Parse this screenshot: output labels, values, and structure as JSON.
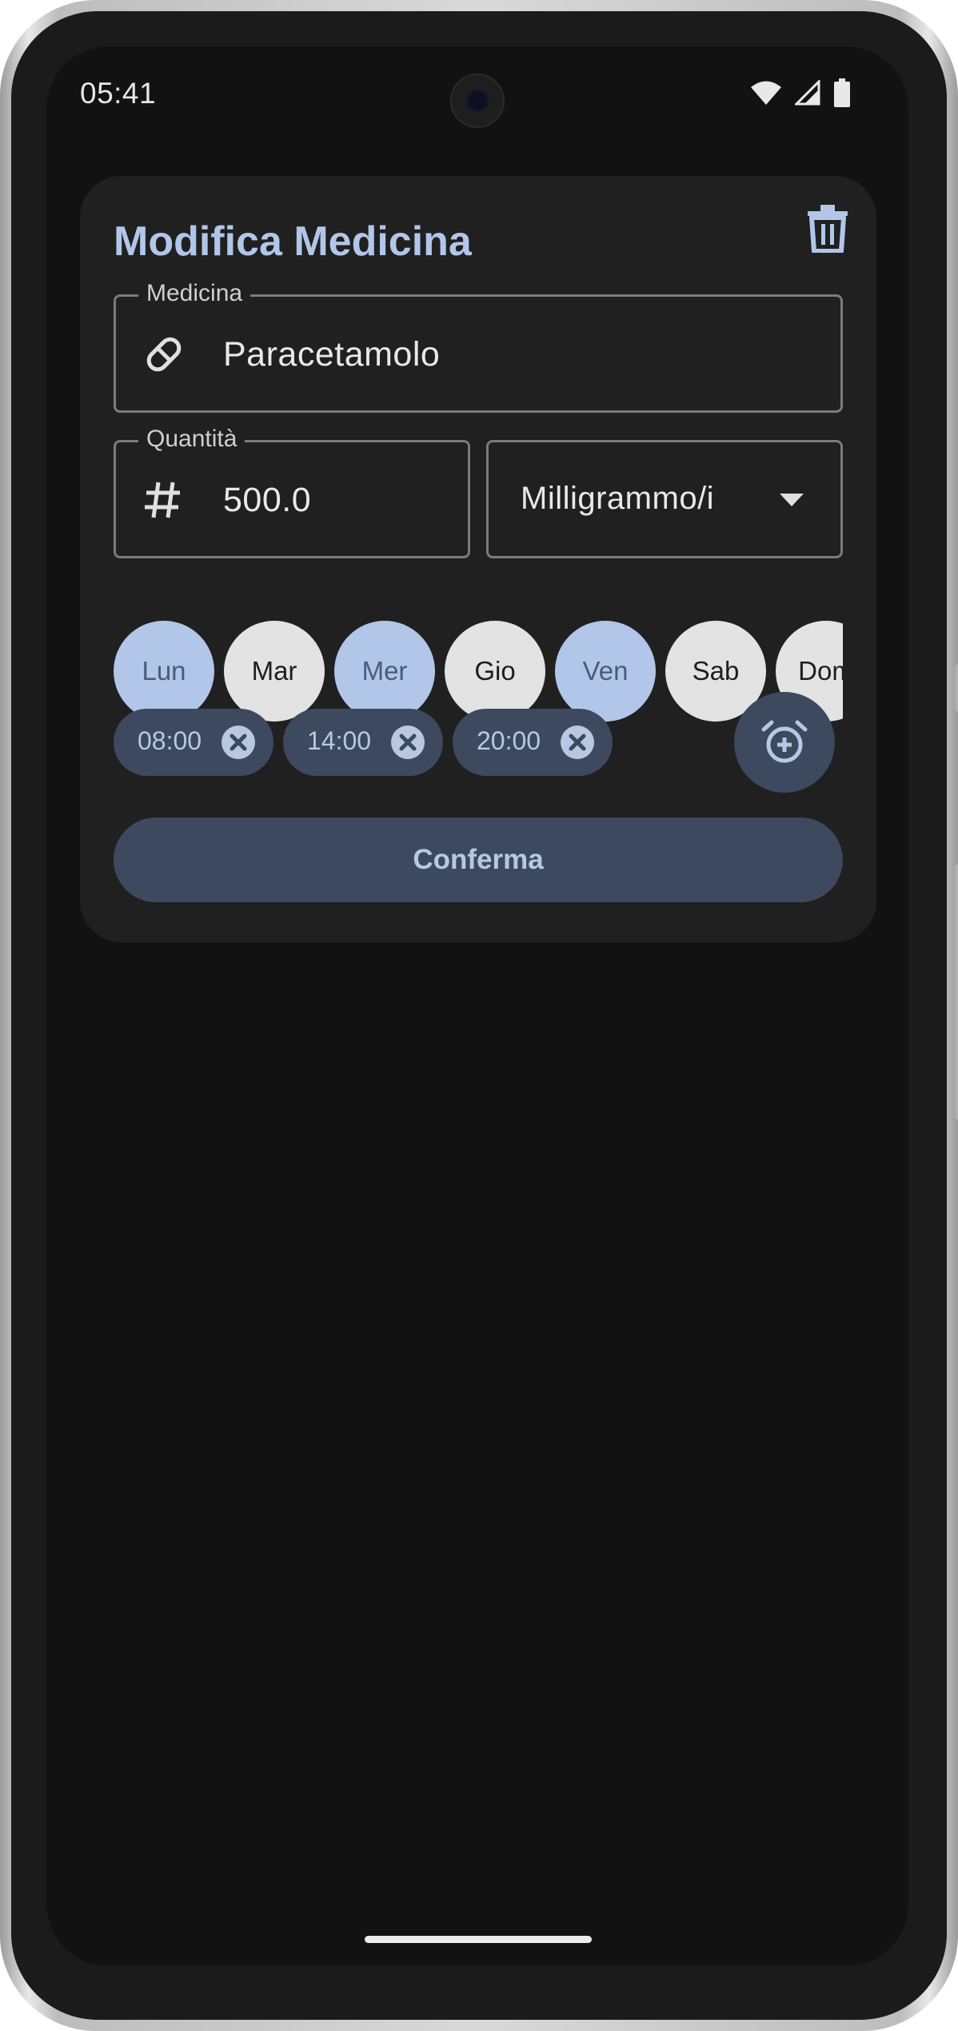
{
  "status_bar": {
    "time": "05:41",
    "icons": [
      "wifi-icon",
      "cell-signal-icon",
      "battery-icon"
    ]
  },
  "dialog": {
    "title": "Modifica Medicina",
    "delete_icon": "trash-icon",
    "medicine": {
      "label": "Medicina",
      "value": "Paracetamolo",
      "icon": "pill-icon"
    },
    "quantity": {
      "label": "Quantità",
      "value": "500.0",
      "icon": "hash-icon"
    },
    "unit": {
      "value": "Milligrammo/i",
      "icon": "dropdown-arrow-icon"
    },
    "days": [
      {
        "label": "Lun",
        "selected": true
      },
      {
        "label": "Mar",
        "selected": false
      },
      {
        "label": "Mer",
        "selected": true
      },
      {
        "label": "Gio",
        "selected": false
      },
      {
        "label": "Ven",
        "selected": true
      },
      {
        "label": "Sab",
        "selected": false
      },
      {
        "label": "Dom",
        "selected": false
      }
    ],
    "times": [
      {
        "label": "08:00"
      },
      {
        "label": "14:00"
      },
      {
        "label": "20:00"
      }
    ],
    "add_time_icon": "alarm-add-icon",
    "confirm_label": "Conferma"
  },
  "colors": {
    "accent": "#b1c6e8",
    "tonal_container": "#3d495e",
    "surface": "#202020",
    "background": "#121212"
  }
}
